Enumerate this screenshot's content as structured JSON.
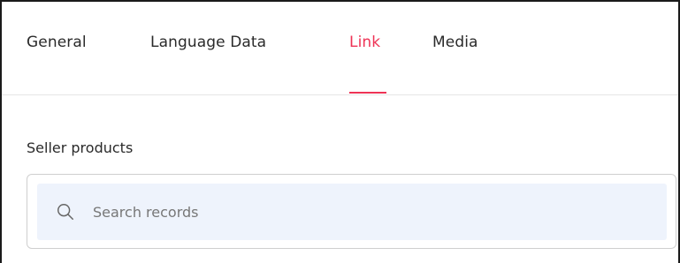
{
  "tabs": [
    {
      "label": "General",
      "active": false
    },
    {
      "label": "Language Data",
      "active": false
    },
    {
      "label": "Link",
      "active": true
    },
    {
      "label": "Media",
      "active": false
    }
  ],
  "colors": {
    "accent": "#ee3355",
    "search_background": "#eef3fc",
    "border": "#cfcfcf"
  },
  "seller_products": {
    "label": "Seller products",
    "search": {
      "placeholder": "Search records",
      "value": "",
      "icon": "search-icon"
    }
  }
}
